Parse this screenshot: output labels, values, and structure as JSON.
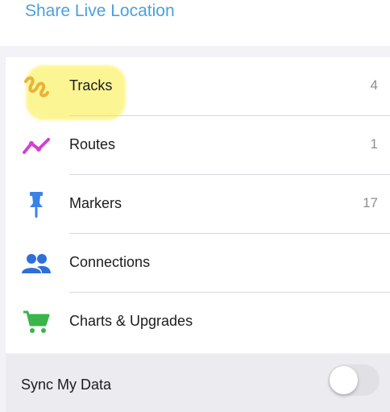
{
  "header": {
    "share_link_label": "Share Live Location"
  },
  "list": {
    "items": [
      {
        "label": "Tracks",
        "count": "4",
        "icon": "track-squiggle-icon",
        "icon_color": "#e8b23a"
      },
      {
        "label": "Routes",
        "count": "1",
        "icon": "route-zigzag-icon",
        "icon_color": "#d43fd6"
      },
      {
        "label": "Markers",
        "count": "17",
        "icon": "push-pin-icon",
        "icon_color": "#3b82e6"
      },
      {
        "label": "Connections",
        "count": "",
        "icon": "people-icon",
        "icon_color": "#2f6fd9"
      },
      {
        "label": "Charts & Upgrades",
        "count": "",
        "icon": "shopping-cart-icon",
        "icon_color": "#3ab54a"
      }
    ]
  },
  "sync": {
    "label": "Sync My Data",
    "enabled": false
  },
  "colors": {
    "link_blue": "#4aa0e0",
    "highlight_yellow": "#fbf37a"
  }
}
